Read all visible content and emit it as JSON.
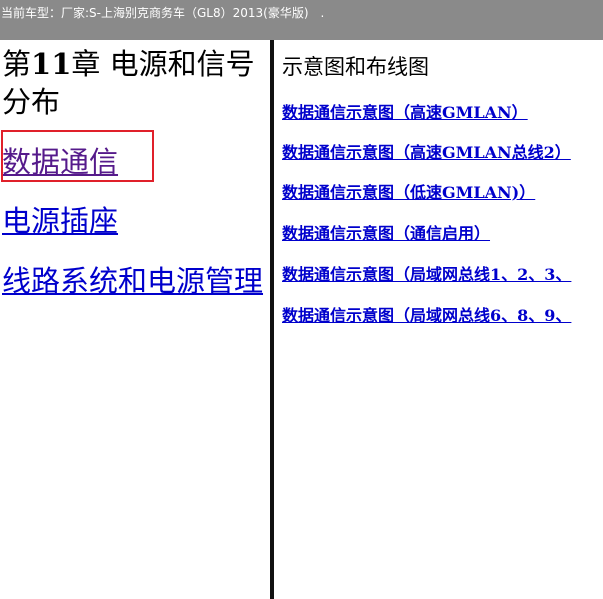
{
  "header": {
    "vehicle_label": "当前车型：",
    "vehicle_value": "厂家:S-上海别克商务车（GL8）2013(豪华版)",
    "trailing": "."
  },
  "left": {
    "chapter_prefix": "第",
    "chapter_number": "11",
    "chapter_suffix": "章 电源和信号分布",
    "links": [
      {
        "label": "数据通信",
        "visited": true,
        "highlighted": true
      },
      {
        "label": "电源插座",
        "visited": false
      },
      {
        "label": "线路系统和电源管理",
        "visited": false
      }
    ]
  },
  "right": {
    "section_title": "示意图和布线图",
    "links": [
      "数据通信示意图（高速GMLAN）",
      "数据通信示意图（高速GMLAN总线2）",
      "数据通信示意图（低速GMLAN)）",
      "数据通信示意图（通信启用）",
      "数据通信示意图（局域网总线1、2、3、",
      "数据通信示意图（局域网总线6、8、9、"
    ]
  },
  "colors": {
    "header_bg": "#8a8a8a",
    "link": "#0000cc",
    "visited_link": "#551a8b",
    "highlight_box": "#e0202a",
    "divider": "#111111"
  }
}
